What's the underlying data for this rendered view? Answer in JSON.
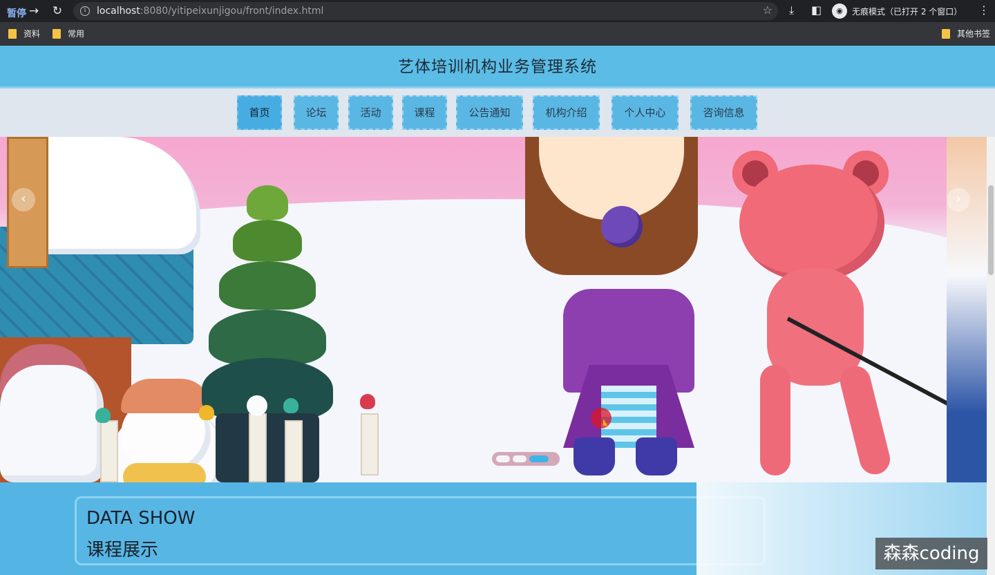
{
  "browser": {
    "pause_label": "暂停",
    "url_host": "localhost",
    "url_rest": ":8080/yitipeixunjigou/front/index.html",
    "incognito_label": "无痕模式（已打开 2 个窗口）",
    "bookmarks": [
      "资料",
      "常用"
    ],
    "other_bookmarks": "其他书签"
  },
  "site": {
    "title": "艺体培训机构业务管理系统"
  },
  "nav": {
    "items": [
      "首页",
      "论坛",
      "活动",
      "课程",
      "公告通知",
      "机构介绍",
      "个人中心",
      "咨询信息"
    ],
    "active_index": 0
  },
  "banner": {
    "prev_label": "‹",
    "next_label": "›",
    "slides": 3,
    "active_slide": 2
  },
  "section": {
    "title_en": "DATA SHOW",
    "title_zh": "课程展示"
  },
  "watermark": "森森coding",
  "colors": {
    "header_bg": "#5bbde6",
    "nav_bg": "#dfe6ee",
    "nav_item_bg": "#5ab7e4",
    "section_bg": "#54b5e4"
  }
}
